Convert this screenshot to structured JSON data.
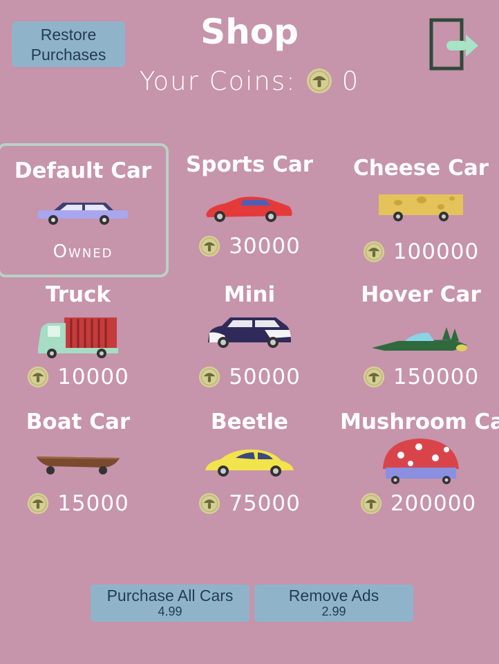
{
  "header": {
    "restore_label_line1": "Restore",
    "restore_label_line2": "Purchases",
    "title": "Shop",
    "coins_label": "Your Coins:",
    "coins_value": "0"
  },
  "cars": [
    {
      "name": "Default Car",
      "status": "Owned",
      "selected": true
    },
    {
      "name": "Sports Car",
      "price": "30000"
    },
    {
      "name": "Cheese Car",
      "price": "100000"
    },
    {
      "name": "Truck",
      "price": "10000"
    },
    {
      "name": "Mini",
      "price": "50000"
    },
    {
      "name": "Hover Car",
      "price": "150000"
    },
    {
      "name": "Boat Car",
      "price": "15000"
    },
    {
      "name": "Beetle",
      "price": "75000"
    },
    {
      "name": "Mushroom Car",
      "price": "200000"
    }
  ],
  "footer": {
    "purchase_all_label": "Purchase All Cars",
    "purchase_all_price": "4.99",
    "remove_ads_label": "Remove Ads",
    "remove_ads_price": "2.99"
  },
  "colors": {
    "background": "#c694ab",
    "button": "#8fb4ca",
    "button_text": "#243b55",
    "coin": "#d6cf95",
    "selected_border": "#b8d2c3",
    "exit_icon": "#2f4a3a"
  },
  "icons": {
    "exit": "exit-door-icon",
    "coin": "mushroom-coin-icon"
  }
}
